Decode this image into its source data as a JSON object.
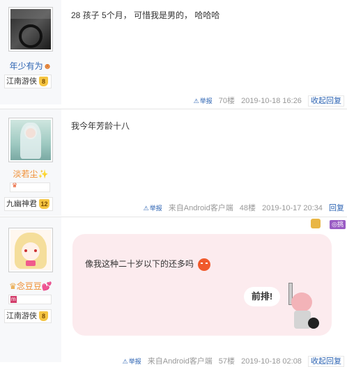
{
  "posts": [
    {
      "username": "年少有为",
      "level_title": "江南游侠",
      "level_num": "8",
      "content": "28 孩子 5个月， 可惜我是男的， 哈哈哈",
      "report": "举报",
      "floor": "70楼",
      "time": "2019-10-18 16:26",
      "action": "收起回复"
    },
    {
      "username": "淡若尘✨",
      "level_title": "九幽神君",
      "level_num": "12",
      "content": "我今年芳龄十八",
      "report": "举报",
      "source": "来自Android客户端",
      "floor": "48楼",
      "time": "2019-10-17 20:34",
      "action": "回复"
    },
    {
      "username": "念豆豆💕",
      "level_title": "江南游侠",
      "level_num": "8",
      "content": "像我这种二十岁以下的还多吗",
      "sticker_text": "前排!",
      "report": "举报",
      "source": "来自Android客户端",
      "floor": "57楼",
      "time": "2019-10-18 02:08",
      "action": "收起回复",
      "top_badge": "挑"
    }
  ],
  "colors": {
    "link": "#2d64b3",
    "bubble": "#fcebee",
    "sidebar": "#f7f8fa"
  }
}
